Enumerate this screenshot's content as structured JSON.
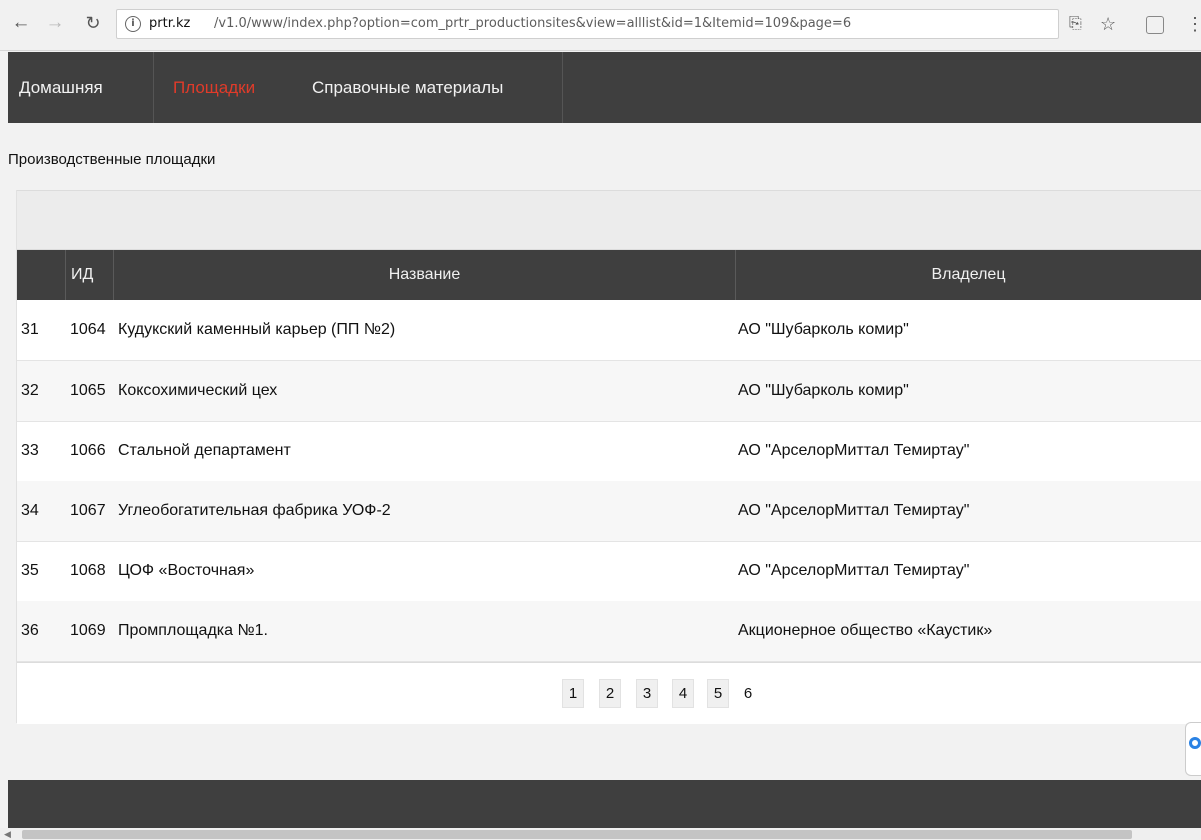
{
  "browser": {
    "url_host": "prtr.kz",
    "url_rest": "/v1.0/www/index.php?option=com_prtr_productionsites&view=alllist&id=1&Itemid=109&page=6"
  },
  "nav": {
    "home": "Домашняя",
    "sites": "Площадки",
    "reference": "Справочные материалы",
    "active_color": "#e03b2a"
  },
  "page": {
    "title": "Производственные площадки"
  },
  "table": {
    "headers": {
      "idx": "",
      "id": "ИД",
      "name": "Название",
      "owner": "Владелец"
    },
    "rows": [
      {
        "idx": "31",
        "id": "1064",
        "name": "Кудукский каменный карьер (ПП №2)",
        "owner": "АО \"Шубарколь комир\""
      },
      {
        "idx": "32",
        "id": "1065",
        "name": "Коксохимический цех",
        "owner": "АО \"Шубарколь комир\""
      },
      {
        "idx": "33",
        "id": "1066",
        "name": "Стальной департамент",
        "owner": "АО \"АрселорМиттал Темиртау\""
      },
      {
        "idx": "34",
        "id": "1067",
        "name": "Углеобогатительная фабрика УОФ-2",
        "owner": "АО \"АрселорМиттал Темиртау\""
      },
      {
        "idx": "35",
        "id": "1068",
        "name": "ЦОФ «Восточная»",
        "owner": "АО \"АрселорМиттал Темиртау\""
      },
      {
        "idx": "36",
        "id": "1069",
        "name": "Промплощадка №1.",
        "owner": "Акционерное общество «Каустик»"
      }
    ]
  },
  "pagination": {
    "pages": [
      "1",
      "2",
      "3",
      "4",
      "5",
      "6"
    ],
    "current": "6"
  }
}
